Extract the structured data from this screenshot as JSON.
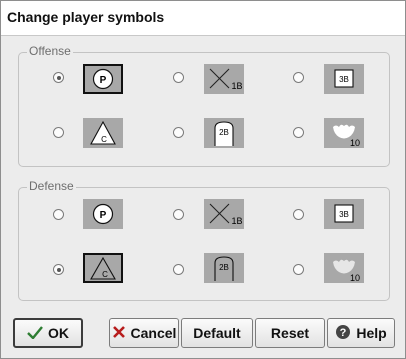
{
  "window": {
    "title": "Change player symbols"
  },
  "offense": {
    "label": "Offense",
    "options": [
      {
        "icon": "pitcher-symbol",
        "text": "P",
        "checked": true
      },
      {
        "icon": "first-base-symbol",
        "text": "1B",
        "checked": false
      },
      {
        "icon": "third-base-symbol",
        "text": "3B",
        "checked": false
      },
      {
        "icon": "catcher-symbol",
        "text": "C",
        "checked": false
      },
      {
        "icon": "second-base-symbol",
        "text": "2B",
        "checked": false
      },
      {
        "icon": "glove-symbol",
        "text": "10",
        "checked": false
      }
    ]
  },
  "defense": {
    "label": "Defense",
    "options": [
      {
        "icon": "pitcher-symbol",
        "text": "P",
        "checked": false
      },
      {
        "icon": "first-base-symbol",
        "text": "1B",
        "checked": false
      },
      {
        "icon": "third-base-symbol",
        "text": "3B",
        "checked": false
      },
      {
        "icon": "catcher-symbol",
        "text": "C",
        "checked": true
      },
      {
        "icon": "second-base-symbol",
        "text": "2B",
        "checked": false
      },
      {
        "icon": "glove-symbol",
        "text": "10",
        "checked": false
      }
    ]
  },
  "buttons": {
    "ok": {
      "label": "OK",
      "icon": "checkmark-icon"
    },
    "cancel": {
      "label": "Cancel",
      "icon": "x-icon"
    },
    "default": {
      "label": "Default"
    },
    "reset": {
      "label": "Reset"
    },
    "help": {
      "label": "Help",
      "icon": "question-icon"
    }
  }
}
